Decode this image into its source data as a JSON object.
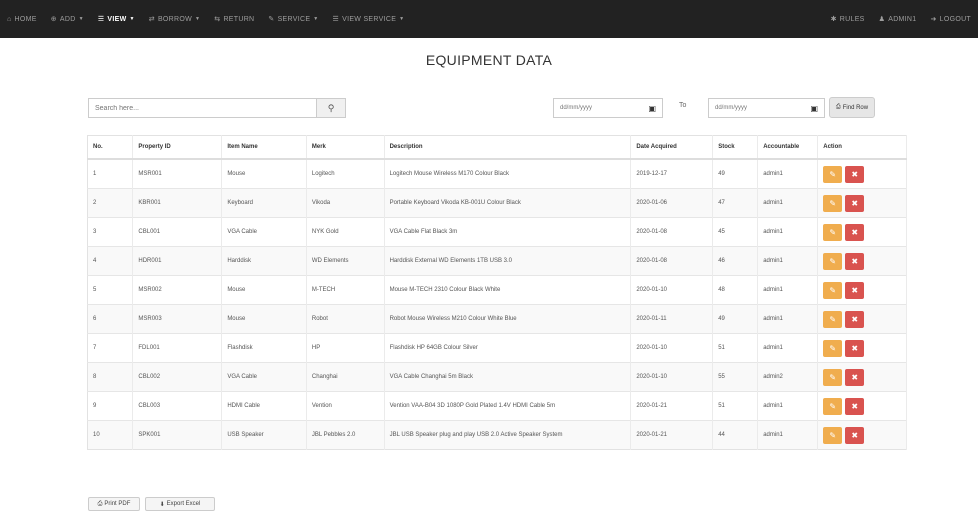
{
  "nav": {
    "left": [
      {
        "label": "HOME",
        "icon": "home-icon",
        "glyph": "⌂",
        "caret": false,
        "active": false
      },
      {
        "label": "ADD",
        "icon": "plus-circle-icon",
        "glyph": "⊕",
        "caret": true,
        "active": false
      },
      {
        "label": "VIEW",
        "icon": "list-icon",
        "glyph": "☰",
        "caret": true,
        "active": true
      },
      {
        "label": "BORROW",
        "icon": "share-icon",
        "glyph": "⇄",
        "caret": true,
        "active": false
      },
      {
        "label": "RETURN",
        "icon": "return-icon",
        "glyph": "⇆",
        "caret": false,
        "active": false
      },
      {
        "label": "SERVICE",
        "icon": "wrench-icon",
        "glyph": "✎",
        "caret": true,
        "active": false
      },
      {
        "label": "VIEW SERVICE",
        "icon": "list-icon",
        "glyph": "☰",
        "caret": true,
        "active": false
      }
    ],
    "right": [
      {
        "label": "RULES",
        "icon": "rules-icon",
        "glyph": "✱"
      },
      {
        "label": "ADMIN1",
        "icon": "user-icon",
        "glyph": "♟"
      },
      {
        "label": "LOGOUT",
        "icon": "logout-icon",
        "glyph": "➜"
      }
    ]
  },
  "page_title": "EQUIPMENT DATA",
  "search": {
    "placeholder": "Search here..."
  },
  "date_from": {
    "placeholder": "dd/mm/yyyy"
  },
  "date_to": {
    "placeholder": "dd/mm/yyyy"
  },
  "to_label": "To",
  "find_button": "Find Row",
  "table": {
    "columns": [
      "No.",
      "Property ID",
      "Item Name",
      "Merk",
      "Description",
      "Date Acquired",
      "Stock",
      "Accountable",
      "Action"
    ],
    "rows": [
      [
        "1",
        "MSR001",
        "Mouse",
        "Logitech",
        "Logitech Mouse Wireless M170 Colour Black",
        "2019-12-17",
        "49",
        "admin1"
      ],
      [
        "2",
        "KBR001",
        "Keyboard",
        "Vikoda",
        "Portable Keyboard Vikoda KB-001U Colour Black",
        "2020-01-06",
        "47",
        "admin1"
      ],
      [
        "3",
        "CBL001",
        "VGA Cable",
        "NYK Gold",
        "VGA Cable Flat Black 3m",
        "2020-01-08",
        "45",
        "admin1"
      ],
      [
        "4",
        "HDR001",
        "Harddisk",
        "WD Elements",
        "Harddisk External WD Elements 1TB USB 3.0",
        "2020-01-08",
        "46",
        "admin1"
      ],
      [
        "5",
        "MSR002",
        "Mouse",
        "M-TECH",
        "Mouse M-TECH 2310 Colour Black White",
        "2020-01-10",
        "48",
        "admin1"
      ],
      [
        "6",
        "MSR003",
        "Mouse",
        "Robot",
        "Robot Mouse Wireless M210 Colour White Blue",
        "2020-01-11",
        "49",
        "admin1"
      ],
      [
        "7",
        "FDL001",
        "Flashdisk",
        "HP",
        "Flashdisk HP 64GB Colour Silver",
        "2020-01-10",
        "51",
        "admin1"
      ],
      [
        "8",
        "CBL002",
        "VGA Cable",
        "Changhai",
        "VGA Cable Changhai 5m Black",
        "2020-01-10",
        "55",
        "admin2"
      ],
      [
        "9",
        "CBL003",
        "HDMI Cable",
        "Vention",
        "Vention VAA-B04 3D 1080P Gold Plated 1.4V HDMI Cable 5m",
        "2020-01-21",
        "51",
        "admin1"
      ],
      [
        "10",
        "SPK001",
        "USB Speaker",
        "JBL Pebbles 2.0",
        "JBL USB Speaker plug and play USB 2.0 Active Speaker System",
        "2020-01-21",
        "44",
        "admin1"
      ]
    ]
  },
  "bottom": {
    "print_pdf": "Print PDF",
    "export_excel": "Export Excel"
  }
}
